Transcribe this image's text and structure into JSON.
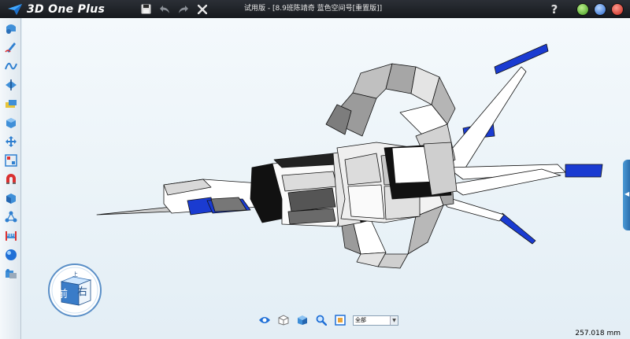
{
  "app": {
    "name": "3D One Plus"
  },
  "window": {
    "title": "试用版 - [8.9班陈靖奇 蓝色空间号[重置版]]"
  },
  "titlebar": {
    "help_label": "?"
  },
  "left_toolbar": {
    "tools": [
      {
        "icon": "basic-solid-icon"
      },
      {
        "icon": "sketch-pencil-icon"
      },
      {
        "icon": "curve-icon"
      },
      {
        "icon": "special-feature-icon"
      },
      {
        "icon": "feature-edit-icon"
      },
      {
        "icon": "combine-solid-icon"
      },
      {
        "icon": "move-icon"
      },
      {
        "icon": "array-icon"
      },
      {
        "icon": "magnet-icon"
      },
      {
        "icon": "material-paint-icon"
      },
      {
        "icon": "assembly-icon"
      },
      {
        "icon": "measure-ruler-icon"
      },
      {
        "icon": "sphere-material-icon"
      },
      {
        "icon": "render-tool-icon"
      }
    ]
  },
  "viewcube": {
    "front_label": "前",
    "right_label": "右",
    "top_label": "上"
  },
  "bottom_toolbar": {
    "tools": [
      {
        "icon": "eye-view-icon"
      },
      {
        "icon": "wireframe-display-icon"
      },
      {
        "icon": "shaded-display-icon"
      },
      {
        "icon": "zoom-icon"
      },
      {
        "icon": "fit-view-icon"
      }
    ],
    "filter_value": "全部"
  },
  "status": {
    "measure": "257.018 mm"
  },
  "colors": {
    "accent_blue": "#1a3bd1",
    "titlebar_bg": "#1e2227",
    "viewport_bg": "#eaf3f8"
  }
}
